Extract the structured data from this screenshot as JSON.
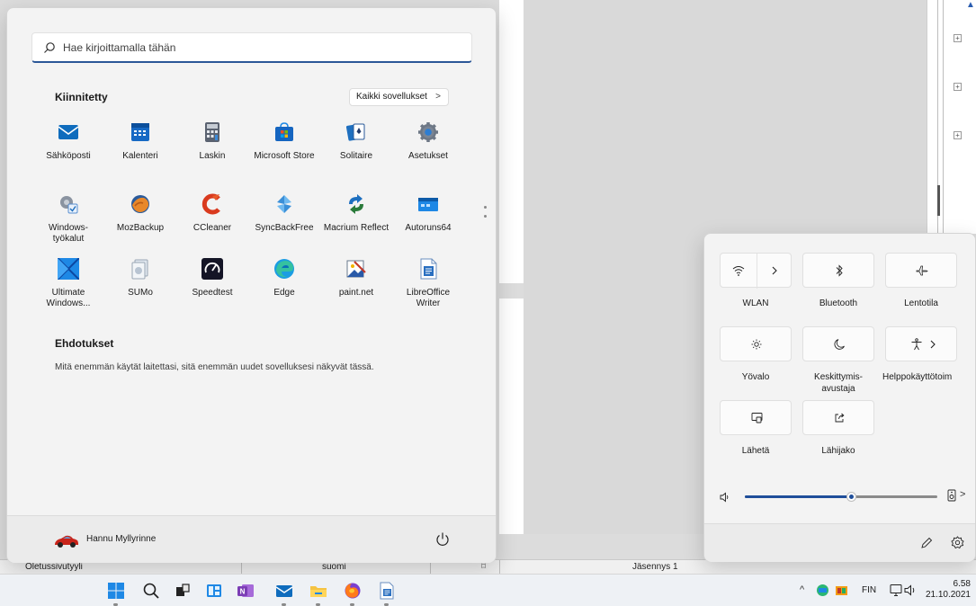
{
  "start_menu": {
    "search_placeholder": "Hae kirjoittamalla tähän",
    "pinned_title": "Kiinnitetty",
    "all_apps_label": "Kaikki sovellukset",
    "pinned_apps": [
      {
        "label": "Sähköposti",
        "icon": "mail-icon"
      },
      {
        "label": "Kalenteri",
        "icon": "calendar-icon"
      },
      {
        "label": "Laskin",
        "icon": "calculator-icon"
      },
      {
        "label": "Microsoft Store",
        "icon": "store-icon"
      },
      {
        "label": "Solitaire",
        "icon": "solitaire-icon"
      },
      {
        "label": "Asetukset",
        "icon": "settings-icon"
      },
      {
        "label": "Windows-työkalut",
        "line1": "Windows-",
        "line2": "työkalut",
        "icon": "windows-tools-icon"
      },
      {
        "label": "MozBackup",
        "icon": "mozbackup-icon"
      },
      {
        "label": "CCleaner",
        "icon": "ccleaner-icon"
      },
      {
        "label": "SyncBackFree",
        "icon": "syncback-icon"
      },
      {
        "label": "Macrium Reflect",
        "icon": "macrium-icon"
      },
      {
        "label": "Autoruns64",
        "icon": "autoruns-icon"
      },
      {
        "label": "Ultimate Windows...",
        "line1": "Ultimate",
        "line2": "Windows...",
        "icon": "ultimate-windows-icon"
      },
      {
        "label": "SUMo",
        "icon": "sumo-icon"
      },
      {
        "label": "Speedtest",
        "icon": "speedtest-icon"
      },
      {
        "label": "Edge",
        "icon": "edge-icon"
      },
      {
        "label": "paint.net",
        "icon": "paintnet-icon"
      },
      {
        "label": "LibreOffice Writer",
        "line1": "LibreOffice",
        "line2": "Writer",
        "icon": "writer-icon"
      }
    ],
    "suggestions_title": "Ehdotukset",
    "suggestions_text": "Mitä enemmän käytät laitettasi, sitä enemmän uudet sovelluksesi näkyvät tässä.",
    "user_name": "Hannu Myllyrinne"
  },
  "quick_settings": {
    "tiles": [
      {
        "label": "WLAN",
        "icon": "wifi-icon"
      },
      {
        "label": "Bluetooth",
        "icon": "bluetooth-icon"
      },
      {
        "label": "Lentotila",
        "icon": "airplane-icon"
      },
      {
        "label": "Yövalo",
        "icon": "night-light-icon"
      },
      {
        "label": "Keskittymis-avustaja",
        "line1": "Keskittymis-",
        "line2": "avustaja",
        "icon": "focus-assist-icon"
      },
      {
        "label": "Helppokäyttötoim",
        "icon": "accessibility-icon"
      },
      {
        "label": "Lähetä",
        "icon": "cast-icon"
      },
      {
        "label": "Lähijako",
        "icon": "nearby-share-icon"
      }
    ],
    "volume_percent": 55
  },
  "background_doc": {
    "status_style": "Oletussivutyyli",
    "status_language": "suomi",
    "status_member": "Jäsennys 1"
  },
  "taskbar": {
    "language": "FIN",
    "time": "6.58",
    "date": "21.10.2021"
  },
  "colors": {
    "accent": "#2b5797",
    "start_bg": "#f3f3f3",
    "taskbar_bg": "#eef1f5"
  }
}
